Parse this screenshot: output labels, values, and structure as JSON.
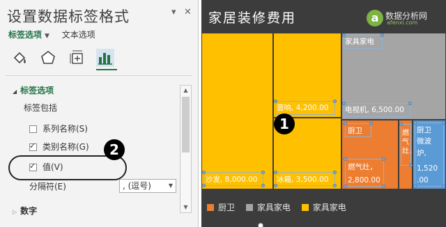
{
  "pane": {
    "title": "设置数据标签格式",
    "pin_icon": "▾",
    "close_icon": "✕",
    "tab_label_options": "标签选项",
    "tab_text_options": "文本选项",
    "icons": [
      "fill-line-icon",
      "effects-pentagon-icon",
      "size-properties-icon",
      "label-options-bar-icon"
    ],
    "section_label_options": "标签选项",
    "label_contains": "标签包括",
    "options": [
      {
        "label": "系列名称(S)",
        "checked": false
      },
      {
        "label": "类别名称(G)",
        "checked": true
      },
      {
        "label": "值(V)",
        "checked": true
      }
    ],
    "separator_label": "分隔符(E)",
    "separator_value": ", (逗号)",
    "section_number": "数字"
  },
  "callouts": {
    "badge_1": "1",
    "badge_2": "2"
  },
  "chart": {
    "title": "家居装修费用",
    "logo_glyph": "a",
    "logo_text": "数据分析网",
    "logo_sub": "afenxi.com",
    "colors": {
      "厨卫": "#ed7d31",
      "家具家电_grey": "#a5a5a5",
      "家具家电_gold": "#ffc000",
      "微波炉": "#5b9bd5",
      "background": "#3c3c3c"
    },
    "tiles": [
      {
        "id": "sofa",
        "label": "沙发, 8,000.00",
        "parent": "家具家电"
      },
      {
        "id": "stereo",
        "label": "音响, 4,200.00",
        "parent": "家具家电"
      },
      {
        "id": "fridge",
        "label": "冰箱, 3,500.00",
        "parent": "家具家电"
      },
      {
        "id": "tv",
        "label": "电视机, 6,500.00",
        "parent": "家具家电"
      },
      {
        "id": "stove",
        "label": "燃气灶, 2,800.00",
        "parent": "厨卫"
      },
      {
        "id": "heater",
        "label": "燃气灶",
        "parent": "厨卫"
      },
      {
        "id": "microwave",
        "label": "厨卫微波炉, 1,520.00",
        "parent": "厨卫"
      }
    ],
    "group_labels": {
      "furniture": "家具家电",
      "kitchen": "厨卫"
    },
    "tile_text": {
      "sofa": "沙发, 8,000.00",
      "stereo": "音响, 4,200.00",
      "fridge": "冰箱, 3,500.00",
      "tv": "电视机, 6,500.00",
      "stove_1": "燃气灶，",
      "stove_2": "2,800.00",
      "heater": "燃气灶，",
      "mw_1": "厨卫",
      "mw_2": "微波",
      "mw_3": "炉,",
      "mw_4": "1,520",
      "mw_5": ".00"
    },
    "legend": [
      {
        "label": "厨卫",
        "color": "#ed7d31"
      },
      {
        "label": "家具家电",
        "color": "#a5a5a5"
      },
      {
        "label": "家具家电",
        "color": "#ffc000"
      }
    ]
  }
}
